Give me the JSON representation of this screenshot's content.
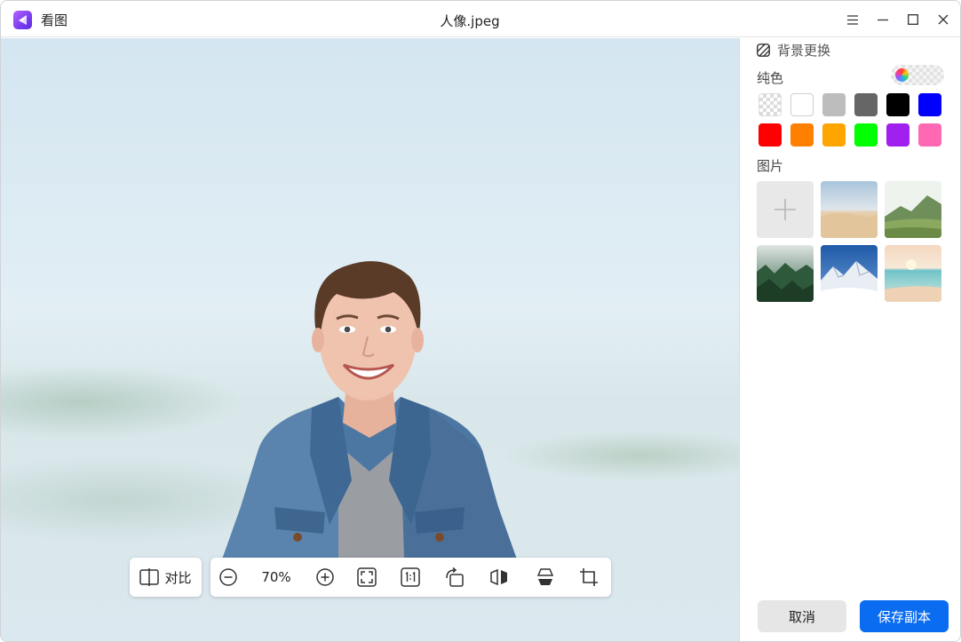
{
  "app": {
    "name": "看图",
    "window_title": "人像.jpeg"
  },
  "toolbar": {
    "compare_label": "对比",
    "zoom_level": "70%"
  },
  "panel": {
    "title": "背景更换",
    "solid_label": "纯色",
    "image_label": "图片",
    "colors": [
      "transparent",
      "#ffffff",
      "#bdbdbd",
      "#666666",
      "#000000",
      "#0000ff",
      "#ff0000",
      "#ff8000",
      "#ffa500",
      "#00ff00",
      "#a020f0",
      "#ff69b4"
    ],
    "cancel_label": "取消",
    "save_label": "保存副本"
  }
}
